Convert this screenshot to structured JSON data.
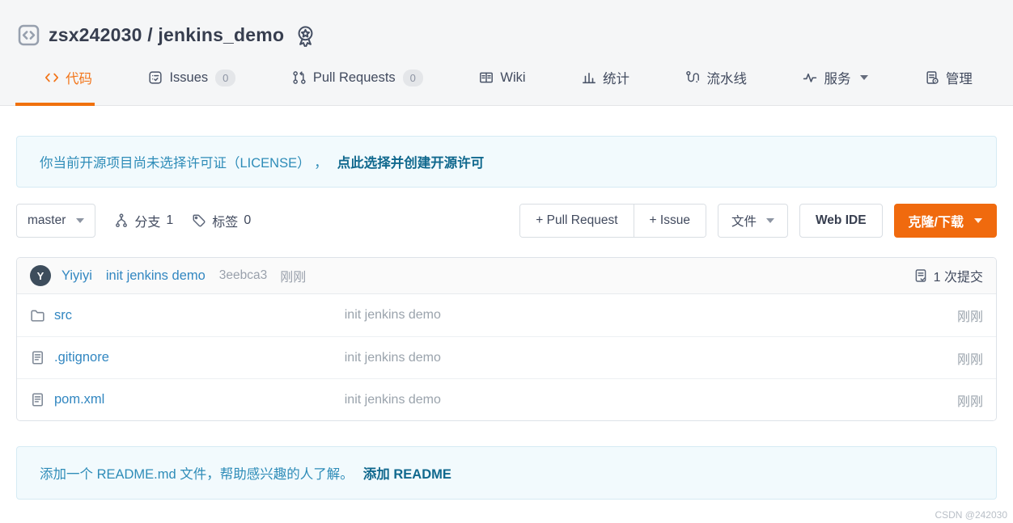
{
  "header": {
    "repo_title": "zsx242030 / jenkins_demo"
  },
  "nav": {
    "tabs": [
      {
        "label": "代码",
        "active": true
      },
      {
        "label": "Issues",
        "badge": "0"
      },
      {
        "label": "Pull Requests",
        "badge": "0"
      },
      {
        "label": "Wiki"
      },
      {
        "label": "统计"
      },
      {
        "label": "流水线"
      },
      {
        "label": "服务"
      },
      {
        "label": "管理"
      }
    ]
  },
  "license_banner": {
    "text": "你当前开源项目尚未选择许可证（LICENSE） ，",
    "link": "点此选择并创建开源许可"
  },
  "branch_bar": {
    "branch_selector": "master",
    "branches_label": "分支",
    "branches_count": "1",
    "tags_label": "标签",
    "tags_count": "0",
    "buttons": {
      "pull_request": "+ Pull Request",
      "issue": "+ Issue",
      "files": "文件",
      "web_ide": "Web IDE",
      "clone": "克隆/下载"
    }
  },
  "commit_bar": {
    "avatar_initial": "Y",
    "author": "Yiyiyi",
    "message": "init jenkins demo",
    "hash": "3eebca3",
    "time": "刚刚",
    "commits_count": "1 次提交"
  },
  "file_table": {
    "rows": [
      {
        "name": "src",
        "type": "folder",
        "message": "init jenkins demo",
        "time": "刚刚"
      },
      {
        "name": ".gitignore",
        "type": "file",
        "message": "init jenkins demo",
        "time": "刚刚"
      },
      {
        "name": "pom.xml",
        "type": "file",
        "message": "init jenkins demo",
        "time": "刚刚"
      }
    ]
  },
  "readme_banner": {
    "text": "添加一个 README.md 文件，帮助感兴趣的人了解。",
    "link": "添加 README"
  },
  "watermark": "CSDN @242030",
  "colors": {
    "accent_orange": "#f06a0e",
    "link_blue": "#3287c1",
    "banner_text": "#2e8cb8",
    "banner_link": "#11698e"
  }
}
